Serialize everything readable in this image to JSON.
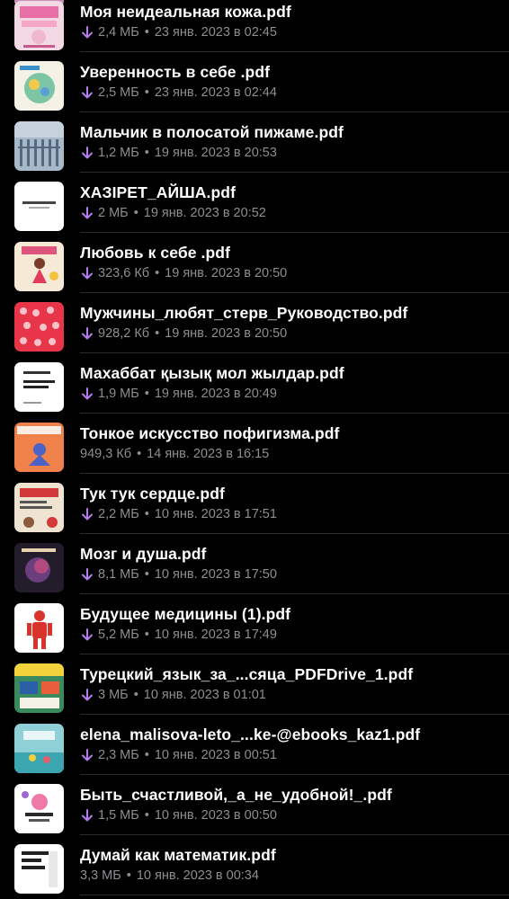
{
  "files": [
    {
      "name": "Моя неидеальная кожа.pdf",
      "size": "2,4 МБ",
      "date": "23 янв. 2023 в 02:45",
      "downloaded": true,
      "thumb": "thumb-moya"
    },
    {
      "name": "Уверенность в себе .pdf",
      "size": "2,5 МБ",
      "date": "23 янв. 2023 в 02:44",
      "downloaded": true,
      "thumb": "thumb-uverennost"
    },
    {
      "name": "Мальчик в полосатой пижаме.pdf",
      "size": "1,2 МБ",
      "date": "19 янв. 2023 в 20:53",
      "downloaded": true,
      "thumb": "thumb-malchik"
    },
    {
      "name": "ХАЗІРЕТ_АЙША.pdf",
      "size": "2 МБ",
      "date": "19 янв. 2023 в 20:52",
      "downloaded": true,
      "thumb": "thumb-aisha"
    },
    {
      "name": "Любовь к себе .pdf",
      "size": "323,6 Кб",
      "date": "19 янв. 2023 в 20:50",
      "downloaded": true,
      "thumb": "thumb-lyubov"
    },
    {
      "name": "Мужчины_любят_стерв_Руководство.pdf",
      "size": "928,2 Кб",
      "date": "19 янв. 2023 в 20:50",
      "downloaded": true,
      "thumb": "thumb-muzhchiny"
    },
    {
      "name": "Махаббат қызық мол жылдар.pdf",
      "size": "1,9 МБ",
      "date": "19 янв. 2023 в 20:49",
      "downloaded": true,
      "thumb": "thumb-mahabbat"
    },
    {
      "name": "Тонкое искусство пофигизма.pdf",
      "size": "949,3 Кб",
      "date": "14 янв. 2023 в 16:15",
      "downloaded": false,
      "thumb": "thumb-pofigizm"
    },
    {
      "name": "Тук тук сердце.pdf",
      "size": "2,2 МБ",
      "date": "10 янв. 2023 в 17:51",
      "downloaded": true,
      "thumb": "thumb-tuk"
    },
    {
      "name": "Мозг и душа.pdf",
      "size": "8,1 МБ",
      "date": "10 янв. 2023 в 17:50",
      "downloaded": true,
      "thumb": "thumb-mozg"
    },
    {
      "name": "Будущее медицины  (1).pdf",
      "size": "5,2 МБ",
      "date": "10 янв. 2023 в 17:49",
      "downloaded": true,
      "thumb": "thumb-medicine"
    },
    {
      "name": "Турецкий_язык_за_...сяца_PDFDrive_1.pdf",
      "size": "3 МБ",
      "date": "10 янв. 2023 в 01:01",
      "downloaded": true,
      "thumb": "thumb-tureckiy"
    },
    {
      "name": "elena_malisova-leto_...ke-@ebooks_kaz1.pdf",
      "size": "2,3 МБ",
      "date": "10 янв. 2023 в 00:51",
      "downloaded": true,
      "thumb": "thumb-leto"
    },
    {
      "name": "Быть_счастливой,_а_не_удобной!_.pdf",
      "size": "1,5 МБ",
      "date": "10 янв. 2023 в 00:50",
      "downloaded": true,
      "thumb": "thumb-schastlivoy"
    },
    {
      "name": "Думай как математик.pdf",
      "size": "3,3 МБ",
      "date": "10 янв. 2023 в 00:34",
      "downloaded": false,
      "thumb": "thumb-matematik"
    }
  ],
  "separator": "•",
  "colors": {
    "background": "#000000",
    "title": "#ffffff",
    "meta": "#8e8e93",
    "download_arrow": "#b57cf0",
    "divider": "#2c2c2e"
  }
}
